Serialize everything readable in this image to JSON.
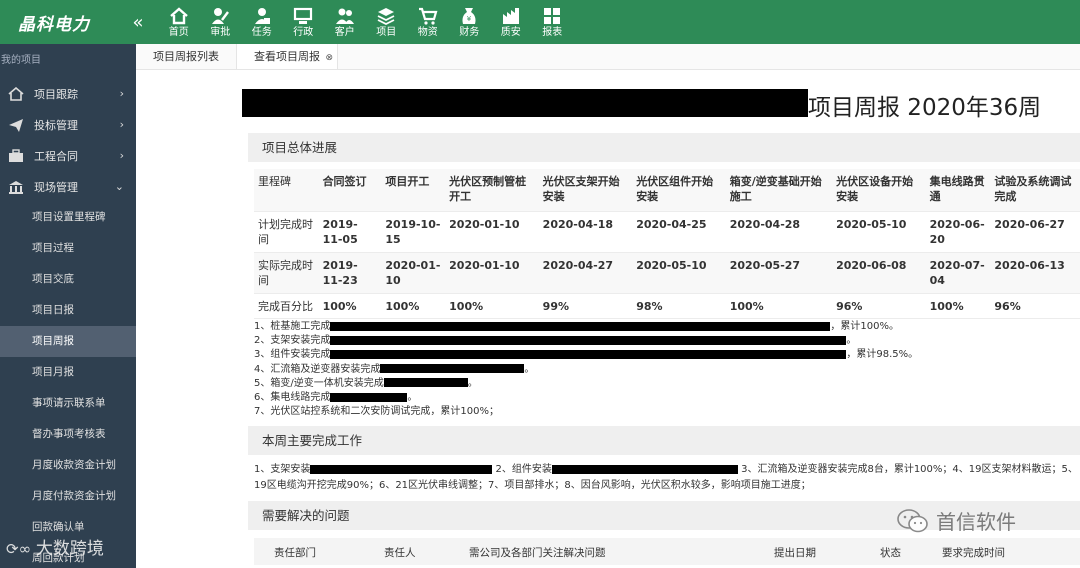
{
  "app": {
    "logo": "晶科电力",
    "collapse": "«"
  },
  "nav": [
    {
      "label": "首页",
      "icon": "home-icon"
    },
    {
      "label": "审批",
      "icon": "approve-icon"
    },
    {
      "label": "任务",
      "icon": "task-icon"
    },
    {
      "label": "行政",
      "icon": "admin-icon"
    },
    {
      "label": "客户",
      "icon": "customer-icon"
    },
    {
      "label": "项目",
      "icon": "project-icon"
    },
    {
      "label": "物资",
      "icon": "cart-icon"
    },
    {
      "label": "财务",
      "icon": "finance-icon"
    },
    {
      "label": "质安",
      "icon": "safety-icon"
    },
    {
      "label": "报表",
      "icon": "report-icon"
    }
  ],
  "sidebar": {
    "title": "我的项目",
    "groups": [
      {
        "label": "项目跟踪",
        "icon": "tracking-icon",
        "chevron": "›"
      },
      {
        "label": "投标管理",
        "icon": "send-icon",
        "chevron": "›"
      },
      {
        "label": "工程合同",
        "icon": "briefcase-icon",
        "chevron": "›"
      },
      {
        "label": "现场管理",
        "icon": "building-icon",
        "chevron": "⌄"
      }
    ],
    "subitems": [
      "项目设置里程碑",
      "项目过程",
      "项目交底",
      "项目日报",
      "项目周报",
      "项目月报",
      "事项请示联系单",
      "督办事项考核表",
      "月度收款资金计划",
      "月度付款资金计划",
      "回款确认单",
      "周回款计划"
    ]
  },
  "tabs": [
    {
      "label": "项目周报列表"
    },
    {
      "label": "查看项目周报",
      "close": "⊗"
    }
  ],
  "report": {
    "title": "项目周报 2020年36周",
    "section1": "项目总体进展",
    "milestones": {
      "headers": [
        "里程碑",
        "合同签订",
        "项目开工",
        "光伏区预制管桩开工",
        "光伏区支架开始安装",
        "光伏区组件开始安装",
        "箱变/逆变基础开始施工",
        "光伏区设备开始安装",
        "集电线路贯通",
        "试验及系统调试完成"
      ],
      "rows": [
        [
          "计划完成时间",
          "2019-11-05",
          "2019-10-15",
          "2020-01-10",
          "2020-04-18",
          "2020-04-25",
          "2020-04-28",
          "2020-05-10",
          "2020-06-20",
          "2020-06-27"
        ],
        [
          "实际完成时间",
          "2019-11-23",
          "2020-01-10",
          "2020-01-10",
          "2020-04-27",
          "2020-05-10",
          "2020-05-27",
          "2020-06-08",
          "2020-07-04",
          "2020-06-13"
        ],
        [
          "完成百分比",
          "100%",
          "100%",
          "100%",
          "99%",
          "98%",
          "100%",
          "96%",
          "100%",
          "96%"
        ]
      ]
    },
    "notes": [
      {
        "pre": "1、桩基施工完成",
        "post": "，累计100%。"
      },
      {
        "pre": "2、支架安装完成",
        "post": "。"
      },
      {
        "pre": "3、组件安装完成",
        "post": "，累计98.5%。"
      },
      {
        "pre": "4、汇流箱及逆变器安装完成",
        "post": "。"
      },
      {
        "pre": "5、箱变/逆变一体机安装完成",
        "post": "。"
      },
      {
        "pre": "6、集电线路完成",
        "post": "。"
      },
      {
        "pre": "7、光伏区站控系统和二次安防调试完成，累计100%；",
        "post": ""
      }
    ],
    "section2": "本周主要完成工作",
    "weekly": {
      "part1": "1、支架安装",
      "part2": " 2、组件安装",
      "part3": " 3、汇流箱及逆变器安装完成8台，累计100%；4、19区支架材料散运；5、19区电缆沟开挖完成90%；6、21区光伏串线调整；7、项目部排水；8、因台风影响，光伏区积水较多，影响项目施工进度；"
    },
    "section3": "需要解决的问题",
    "issues_headers": [
      "责任部门",
      "责任人",
      "需公司及各部门关注解决问题",
      "提出日期",
      "状态",
      "要求完成时间"
    ]
  },
  "watermarks": {
    "wechat": "首信软件",
    "bottom": "大数跨境"
  }
}
